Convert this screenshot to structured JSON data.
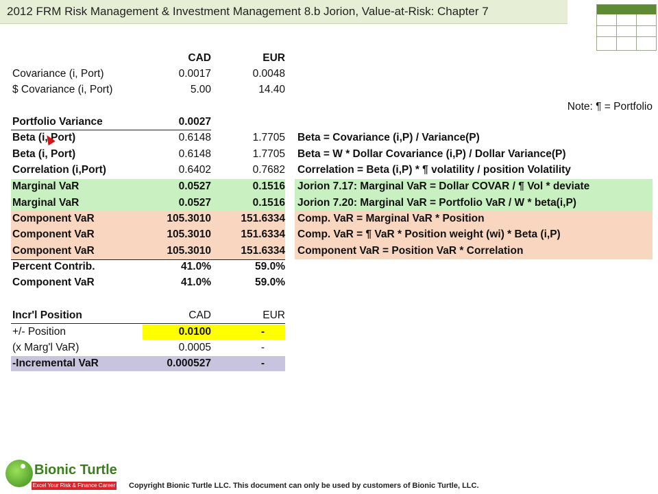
{
  "title": "2012 FRM Risk Management & Investment Management 8.b Jorion, Value-at-Risk: Chapter 7",
  "note": "Note: ¶ = Portfolio",
  "headers": {
    "cad": "CAD",
    "eur": "EUR"
  },
  "rows": {
    "cov": {
      "label": "Covariance (i, Port)",
      "cad": "0.0017",
      "eur": "0.0048"
    },
    "dcov": {
      "label": "$ Covariance (i, Port)",
      "cad": "5.00",
      "eur": "14.40"
    },
    "pvar": {
      "label": "Portfolio Variance",
      "cad": "0.0027"
    },
    "beta1": {
      "label": "Beta (i, Port)",
      "cad": "0.6148",
      "eur": "1.7705",
      "formula": "Beta = Covariance (i,P) / Variance(P)"
    },
    "beta2": {
      "label": "Beta (i, Port)",
      "cad": "0.6148",
      "eur": "1.7705",
      "formula": "Beta = W * Dollar Covariance (i,P) / Dollar Variance(P)"
    },
    "corr": {
      "label": "Correlation (i,Port)",
      "cad": "0.6402",
      "eur": "0.7682",
      "formula": "Correlation = Beta (i,P) * ¶ volatility / position Volatility"
    },
    "mvar1": {
      "label": "Marginal VaR",
      "cad": "0.0527",
      "eur": "0.1516",
      "formula": "Jorion 7.17: Marginal VaR = Dollar COVAR / ¶ Vol * deviate"
    },
    "mvar2": {
      "label": "Marginal VaR",
      "cad": "0.0527",
      "eur": "0.1516",
      "formula": "Jorion 7.20: Marginal VaR = Portfolio VaR / W * beta(i,P)"
    },
    "cvar1": {
      "label": "Component VaR",
      "cad": "105.3010",
      "eur": "151.6334",
      "formula": "Comp. VaR = Marginal VaR * Position"
    },
    "cvar2": {
      "label": "Component VaR",
      "cad": "105.3010",
      "eur": "151.6334",
      "formula": "Comp. VaR = ¶ VaR * Position weight (wi) * Beta (i,P)"
    },
    "cvar3": {
      "label": "Component VaR",
      "cad": "105.3010",
      "eur": "151.6334",
      "formula": "Component VaR = Position VaR * Correlation"
    },
    "pct": {
      "label": "Percent Contrib.",
      "cad": "41.0%",
      "eur": "59.0%"
    },
    "cvar4": {
      "label": "Component VaR",
      "cad": "41.0%",
      "eur": "59.0%"
    }
  },
  "incr": {
    "header": {
      "label": "Incr'l Position",
      "cad": "CAD",
      "eur": "EUR"
    },
    "pos": {
      "label": "+/- Position",
      "cad": "0.0100",
      "eur": "-"
    },
    "marg": {
      "label": "(x Marg'l VaR)",
      "cad": "0.0005",
      "eur": "-"
    },
    "ivar": {
      "label": "-Incremental VaR",
      "cad": "0.000527",
      "eur": "-"
    }
  },
  "footer": {
    "logo_name": "Bionic Turtle",
    "logo_tagline": "Excel Your Risk & Finance Career",
    "copyright": "Copyright Bionic Turtle LLC.  This document can only be used by customers of Bionic Turtle, LLC."
  },
  "colors": {
    "title_bg": "#e6efd6",
    "marginal_fill": "#c8f0c0",
    "component_fill": "#f9d6bf",
    "input_fill": "#ffff00",
    "incremental_fill": "#c9c4de"
  }
}
